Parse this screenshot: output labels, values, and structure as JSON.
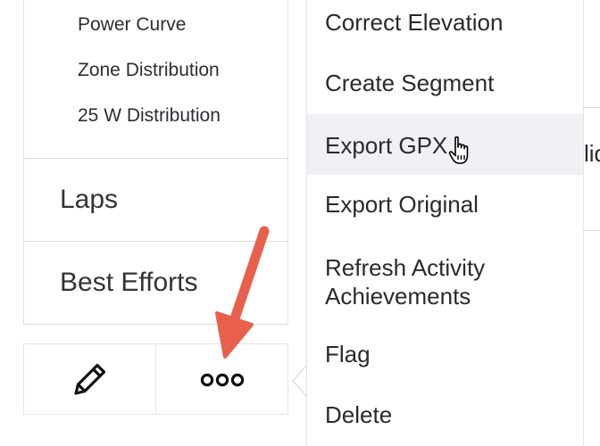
{
  "sidebar": {
    "sub_items": [
      "Power Curve",
      "Zone Distribution",
      "25 W Distribution"
    ],
    "sections": [
      {
        "label": "Laps"
      },
      {
        "label": "Best Efforts"
      }
    ],
    "actions": [
      {
        "name": "edit",
        "icon": "pencil-icon"
      },
      {
        "name": "more",
        "icon": "ellipsis-icon"
      }
    ]
  },
  "menu": {
    "items": [
      {
        "label": "Correct Elevation"
      },
      {
        "label": "Create Segment"
      },
      {
        "label": "Export GPX",
        "state": "hovered"
      },
      {
        "label": "Export Original"
      },
      {
        "label": "Refresh Activity Achievements"
      },
      {
        "label": "Flag"
      },
      {
        "label": "Delete"
      }
    ]
  },
  "peek_text": "lid",
  "annotation": {
    "arrow_color": "#e8604c"
  }
}
